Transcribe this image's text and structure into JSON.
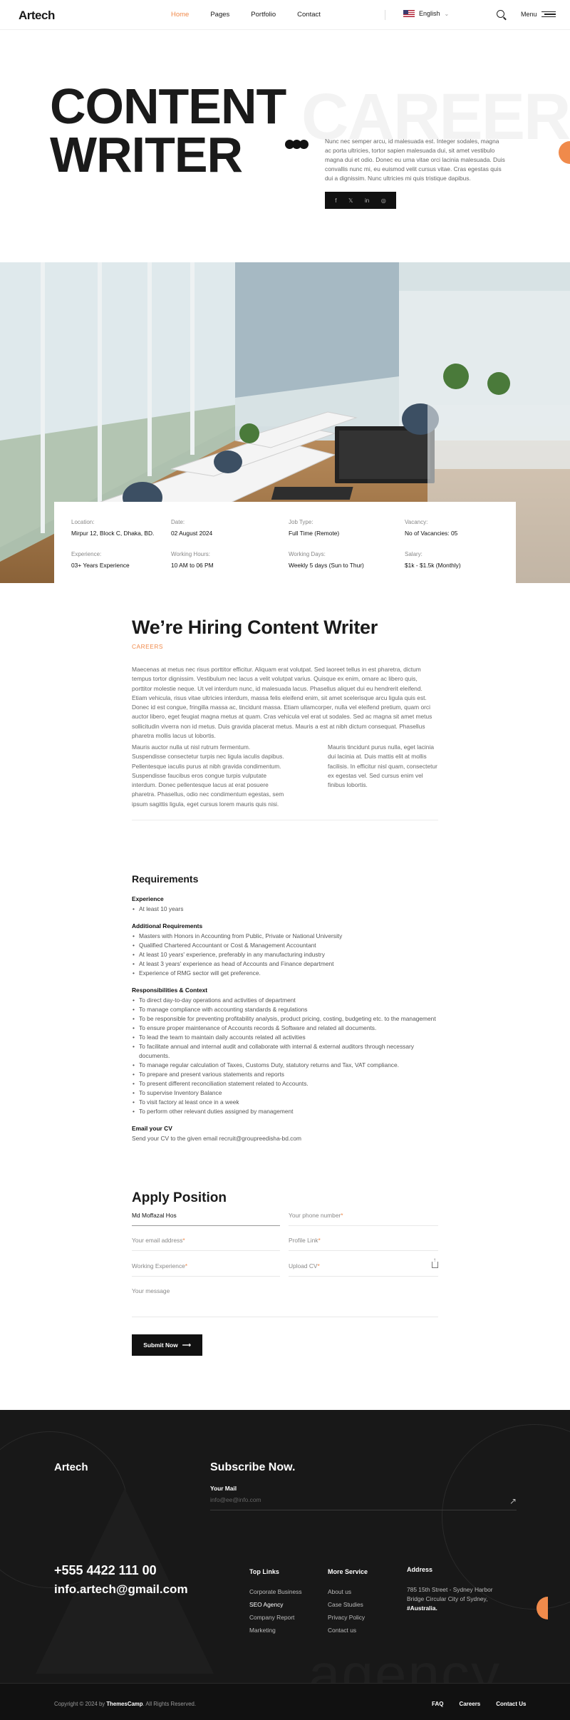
{
  "header": {
    "logo": "Artech",
    "nav": [
      "Home",
      "Pages",
      "Portfolio",
      "Contact"
    ],
    "language": "English",
    "menu_label": "Menu"
  },
  "hero": {
    "title_line1": "CONTENT",
    "title_line2": "WRITER",
    "ghost_word": "CAREERS",
    "description": "Nunc nec semper arcu, id malesuada est. Integer sodales, magna ac porta ultricies, tortor sapien malesuada dui, sit amet vestibulo magna dui et odio. Donec eu urna vitae orci lacinia malesuada. Duis convallis nunc mi, eu euismod velit cursus vitae. Cras egestas quis dui a dignissim. Nunc ultricies mi quis tristique dapibus.",
    "social_icons": [
      "facebook-icon",
      "x-icon",
      "linkedin-icon",
      "instagram-icon"
    ],
    "social_glyphs": [
      "f",
      "𝕏",
      "in",
      "◎"
    ]
  },
  "job_info": [
    {
      "label": "Location:",
      "value": "Mirpur 12, Block C, Dhaka, BD."
    },
    {
      "label": "Date:",
      "value": "02 August 2024"
    },
    {
      "label": "Job Type:",
      "value": "Full Time (Remote)"
    },
    {
      "label": "Vacancy:",
      "value": "No of Vacancies: 05"
    },
    {
      "label": "Experience:",
      "value": "03+ Years Experience"
    },
    {
      "label": "Working Hours:",
      "value": "10 AM to 06 PM"
    },
    {
      "label": "Working Days:",
      "value": "Weekly 5 days (Sun to Thur)"
    },
    {
      "label": "Salary:",
      "value": "$1k - $1.5k (Monthly)"
    }
  ],
  "article": {
    "title": "We’re Hiring Content Writer",
    "tag": "CAREERS",
    "intro": "Maecenas at metus nec risus porttitor efficitur. Aliquam erat volutpat. Sed laoreet tellus in est pharetra, dictum tempus tortor dignissim. Vestibulum nec lacus a velit volutpat varius. Quisque ex enim, ornare ac libero quis, porttitor molestie neque. Ut vel interdum nunc, id malesuada lacus. Phasellus aliquet dui eu hendrerit eleifend. Etiam vehicula, risus vitae ultricies interdum, massa felis eleifend enim, sit amet scelerisque arcu ligula quis est. Donec id est congue, fringilla massa ac, tincidunt massa. Etiam ullamcorper, nulla vel eleifend pretium, quam orci auctor libero, eget feugiat magna metus at quam. Cras vehicula vel erat ut sodales. Sed ac magna sit amet metus sollicitudin viverra non id metus. Duis gravida placerat metus. Mauris a est at nibh dictum consequat. Phasellus pharetra mollis lacus ut lobortis.",
    "col1": "Mauris auctor nulla ut nisl rutrum fermentum. Suspendisse consectetur turpis nec ligula iaculis dapibus. Pellentesque iaculis purus at nibh gravida condimentum. Suspendisse faucibus eros congue turpis vulputate interdum. Donec pellentesque lacus at erat posuere pharetra. Phasellus, odio nec condimentum egestas, sem ipsum sagittis ligula, eget cursus lorem mauris quis nisi.",
    "col2": "Mauris tincidunt purus nulla, eget lacinia dui lacinia at. Duis mattis elit at mollis facilisis. In efficitur nisl quam, consectetur ex egestas vel. Sed cursus enim vel finibus lobortis."
  },
  "requirements": {
    "title": "Requirements",
    "sections": [
      {
        "heading": "Experience",
        "items": [
          "At least 10 years"
        ]
      },
      {
        "heading": "Additional Requirements",
        "items": [
          "Masters with Honors in Accounting from Public, Private or National University",
          "Qualified Chartered Accountant or Cost & Management Accountant",
          "At least 10 years' experience, preferably in any manufacturing industry",
          "At least 3 years' experience as head of Accounts and Finance department",
          "Experience of RMG sector will get preference."
        ]
      },
      {
        "heading": "Responsibilities & Context",
        "items": [
          "To direct day-to-day operations and activities of department",
          "To manage compliance with accounting standards & regulations",
          "To be responsible for preventing profitability analysis, product pricing, costing, budgeting etc. to the management",
          "To ensure proper maintenance of Accounts records & Software and related all documents.",
          "To lead the team to maintain daily accounts related all activities",
          "To facilitate annual and internal audit and collaborate with internal & external auditors through necessary documents.",
          "To manage regular calculation of Taxes, Customs Duty, statutory returns and Tax, VAT compliance.",
          "To prepare and present various statements and reports",
          "To present different reconciliation statement related to Accounts.",
          "To supervise Inventory Balance",
          "To visit factory at least once in a week",
          "To perform other relevant duties assigned by management"
        ]
      }
    ],
    "email_heading": "Email your CV",
    "email_text": "Send your CV to the given email recruit@groupreedisha-bd.com"
  },
  "apply": {
    "title": "Apply Position",
    "name_value": "Md Moffazal Hos",
    "phone_placeholder": "Your phone number",
    "email_placeholder": "Your email address",
    "profile_placeholder": "Profile Link",
    "experience_placeholder": "Working Experience",
    "cv_placeholder": "Upload CV",
    "message_placeholder": "Your message",
    "required_mark": "*",
    "submit_label": "Submit Now",
    "submit_arrow": "⟶"
  },
  "footer": {
    "logo": "Artech",
    "subscribe_title": "Subscribe Now.",
    "mail_label": "Your Mail",
    "mail_placeholder": "info@ee@info.com",
    "phone": "+555 4422 111 00",
    "email": "info.artech@gmail.com",
    "top_links_title": "Top Links",
    "top_links": [
      "Corporate Business",
      "SEO Agency",
      "Company Report",
      "Marketing"
    ],
    "more_service_title": "More Service",
    "more_service": [
      "About us",
      "Case Studies",
      "Privacy Policy",
      "Contact us"
    ],
    "address_title": "Address",
    "address_lines": [
      "785 15th Street - Sydney Harbor",
      "Bridge Circular City of Sydney,"
    ],
    "address_country": "#Australia.",
    "ghost_word": "agency",
    "copyright_prefix": "Copyright © 2024 by",
    "copyright_brand": "ThemesCamp",
    "copyright_suffix": ". All Rights Reserved.",
    "bottom_links": [
      "FAQ",
      "Careers",
      "Contact Us"
    ]
  }
}
